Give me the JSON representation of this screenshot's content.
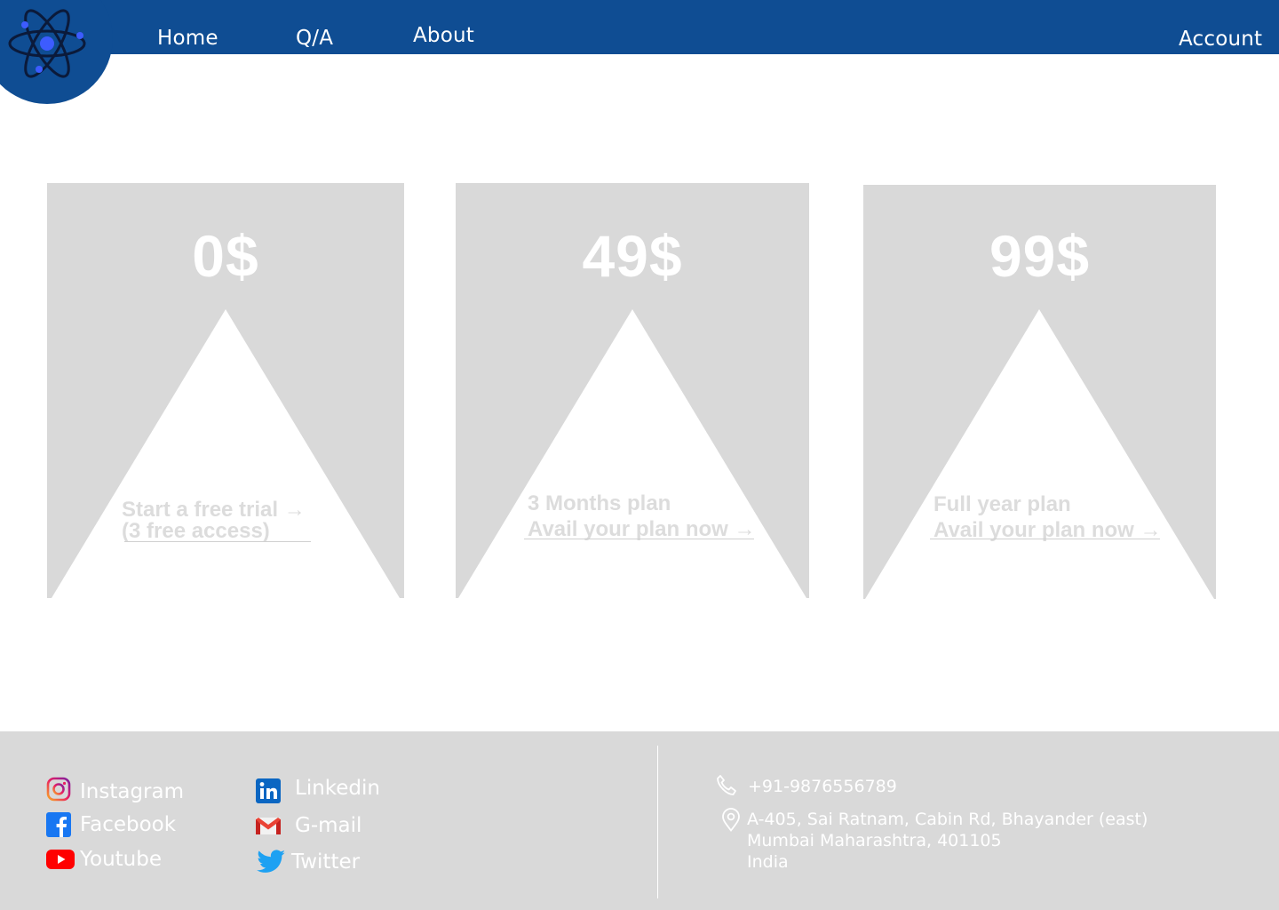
{
  "nav": {
    "home": "Home",
    "qa": "Q/A",
    "about": "About",
    "account": "Account"
  },
  "plans": [
    {
      "price": "0$",
      "line1": "Start a free trial →",
      "line2": "(3 free access)"
    },
    {
      "price": "49$",
      "line1": "3 Months plan",
      "line2": "Avail your plan now →"
    },
    {
      "price": "99$",
      "line1": "Full year plan",
      "line2": "Avail your plan now →"
    }
  ],
  "footer": {
    "social": {
      "instagram": "Instagram",
      "facebook": "Facebook",
      "youtube": "Youtube",
      "linkedin": "Linkedin",
      "gmail": "G-mail",
      "twitter": "Twitter"
    },
    "contact": {
      "phone": "+91-9876556789",
      "address_line1": "A-405, Sai Ratnam, Cabin Rd, Bhayander (east)",
      "address_line2": "Mumbai Maharashtra, 401105",
      "address_line3": "India"
    }
  },
  "colors": {
    "brand_blue": "#0f4d93",
    "card_gray": "#d9d9d9",
    "footer_gray": "#d9d9d9"
  },
  "icons": [
    "atom-logo-icon",
    "instagram-icon",
    "facebook-icon",
    "youtube-icon",
    "linkedin-icon",
    "gmail-icon",
    "twitter-icon",
    "phone-icon",
    "location-pin-icon"
  ]
}
